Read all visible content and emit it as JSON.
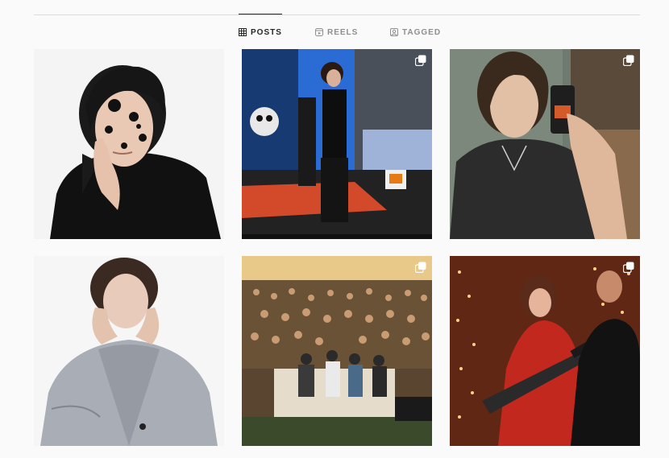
{
  "profile_tabs": {
    "posts": {
      "label": "POSTS",
      "icon": "grid-icon"
    },
    "reels": {
      "label": "REELS",
      "icon": "reels-icon"
    },
    "tagged": {
      "label": "TAGGED",
      "icon": "tagged-icon"
    },
    "active": "posts"
  },
  "posts": [
    {
      "row": 1,
      "col": 1,
      "multi_photo": false
    },
    {
      "row": 1,
      "col": 2,
      "multi_photo": true
    },
    {
      "row": 1,
      "col": 3,
      "multi_photo": true
    },
    {
      "row": 2,
      "col": 1,
      "multi_photo": false
    },
    {
      "row": 2,
      "col": 2,
      "multi_photo": true
    },
    {
      "row": 2,
      "col": 3,
      "multi_photo": true
    }
  ],
  "colors": {
    "page_background": "#fafafa",
    "active_tab": "#262626",
    "inactive_tab": "#8e8e8e",
    "divider": "#dbdbdb"
  }
}
